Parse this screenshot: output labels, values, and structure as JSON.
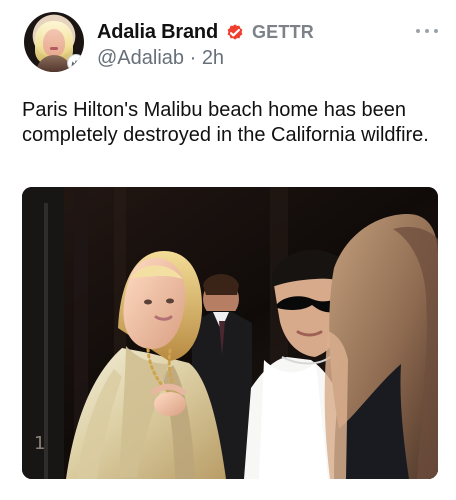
{
  "post": {
    "author": {
      "display_name": "Adalia Brand",
      "handle": "@Adaliab",
      "time": "2h",
      "platform": "GETTR"
    },
    "text": "Paris Hilton's Malibu beach home has been completely destroyed in the California wildfire.",
    "icons": {
      "verified": "verified-badge-icon",
      "more": "more-options-icon",
      "avatar_badge": "crown-icon"
    },
    "colors": {
      "verified": "#ef3f2f",
      "muted": "#677079",
      "platform": "#7c8288",
      "text": "#111111"
    }
  }
}
